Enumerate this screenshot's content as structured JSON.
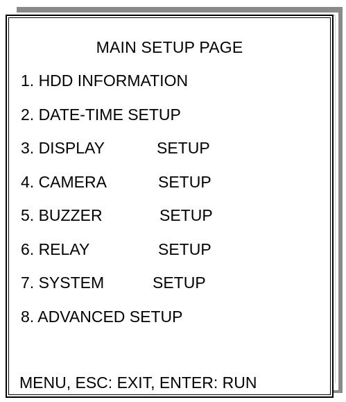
{
  "menu": {
    "title": "MAIN SETUP PAGE",
    "items": [
      {
        "label": "1. HDD INFORMATION",
        "setup": ""
      },
      {
        "label": "2. DATE-TIME SETUP",
        "setup": ""
      },
      {
        "label": "3. DISPLAY",
        "setup": "SETUP"
      },
      {
        "label": "4. CAMERA",
        "setup": "SETUP"
      },
      {
        "label": "5. BUZZER",
        "setup": "SETUP"
      },
      {
        "label": "6. RELAY",
        "setup": "SETUP"
      },
      {
        "label": "7. SYSTEM",
        "setup": "SETUP"
      },
      {
        "label": "8. ADVANCED SETUP",
        "setup": ""
      }
    ],
    "footer": "MENU, ESC: EXIT, ENTER: RUN"
  },
  "colors": {
    "background": "#ffffff",
    "text": "#000000",
    "border": "#000000",
    "shadow": "#8a8a8a"
  }
}
